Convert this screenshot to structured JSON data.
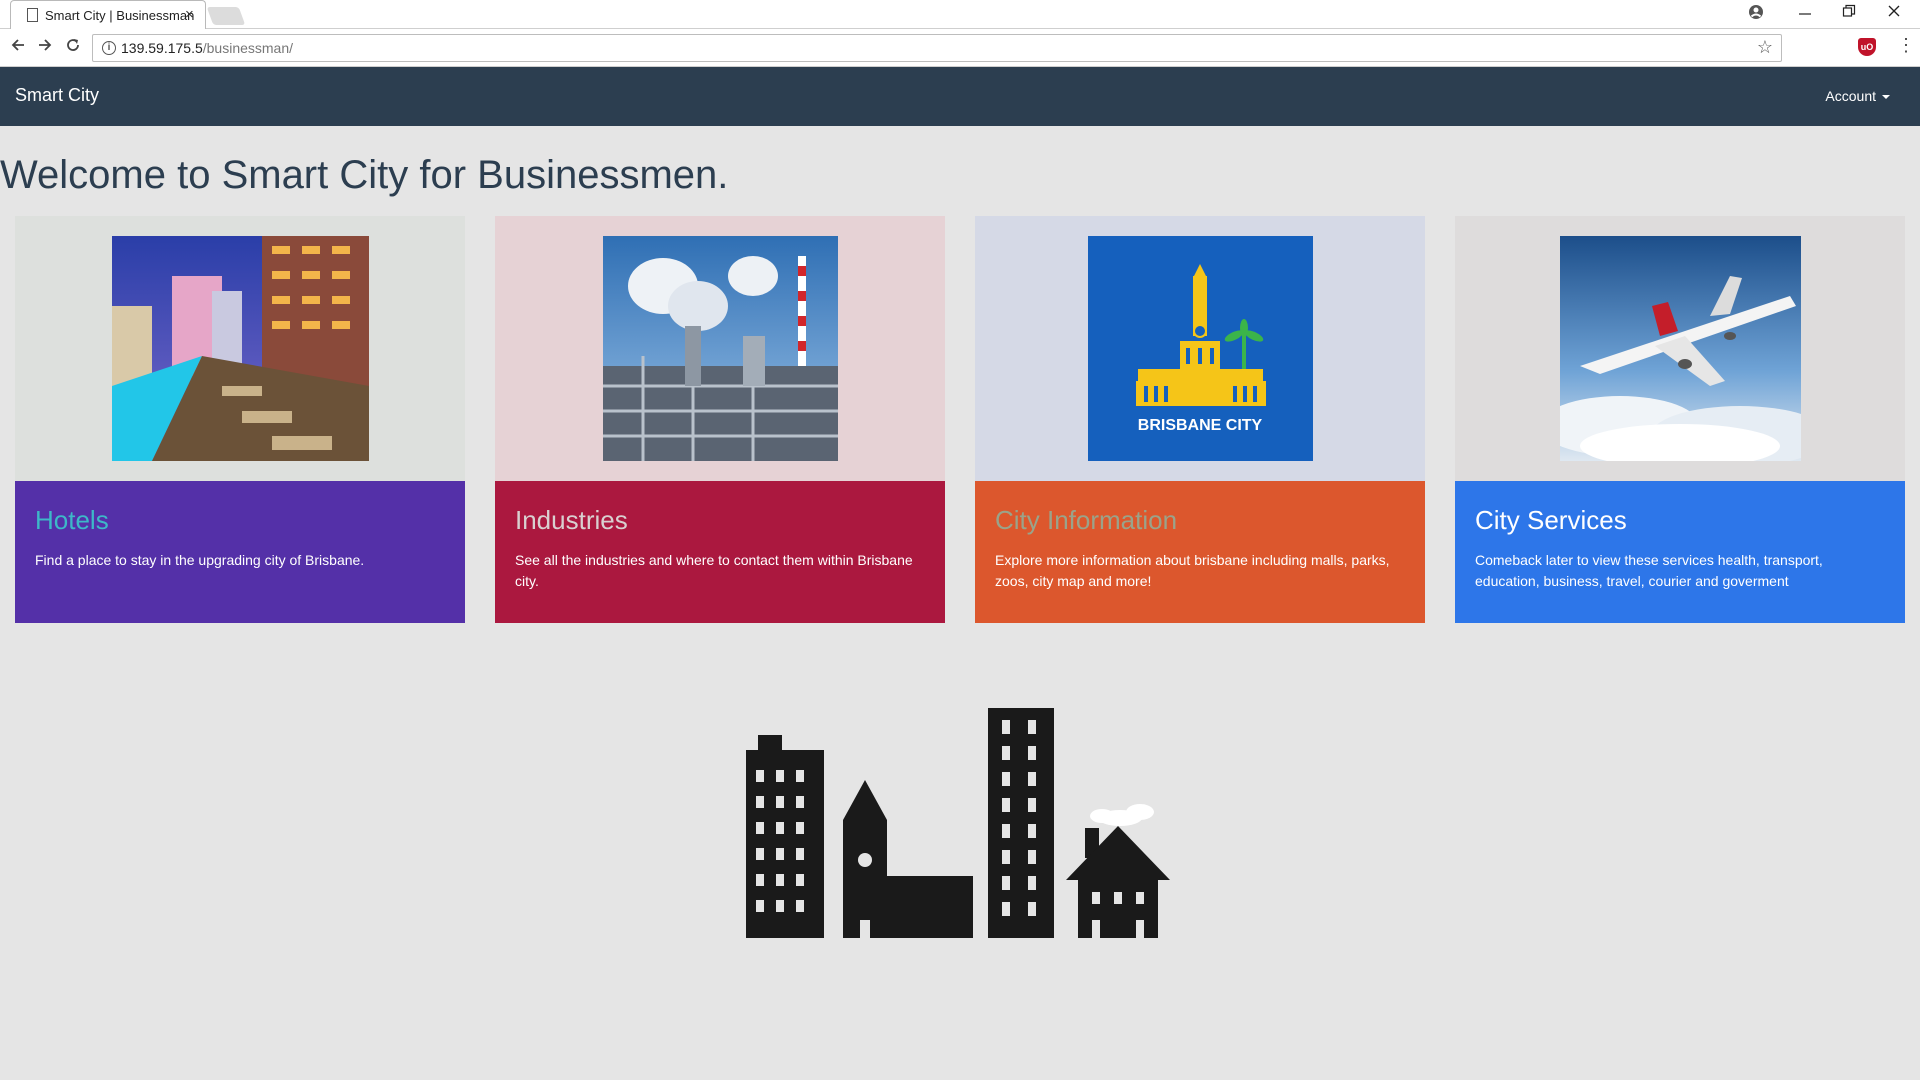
{
  "browser": {
    "tab_title": "Smart City | Businessman",
    "tab_close": "×",
    "url_host": "139.59.175.5",
    "url_path": "/businessman/",
    "info_icon": "i",
    "extension_label": "uO",
    "icons": [
      "back-arrow-icon",
      "forward-arrow-icon",
      "reload-icon",
      "info-icon",
      "star-icon",
      "extension-icon",
      "kebab-menu-icon",
      "profile-icon",
      "minimize-icon",
      "restore-icon",
      "close-icon"
    ]
  },
  "navbar": {
    "brand": "Smart City",
    "account": "Account",
    "background": "#2c3e50"
  },
  "page": {
    "title": "Welcome to Smart City for Businessmen."
  },
  "cards": [
    {
      "title": "Hotels",
      "text": "Find a place to stay in the upgrading city of Brisbane.",
      "top_color": "#dde0dd",
      "bottom_color": "#5430a8",
      "title_color": "#3db8c8",
      "image": "hotel-pool-image"
    },
    {
      "title": "Industries",
      "text": "See all the industries and where to contact them within Brisbane city.",
      "top_color": "#e6d2d5",
      "bottom_color": "#ab183f",
      "title_color": "#d9d0d0",
      "image": "factory-image"
    },
    {
      "title": "City Information",
      "text": "Explore more information about brisbane including malls, parks, zoos, city map and more!",
      "top_color": "#d5d9e6",
      "bottom_color": "#dc572d",
      "title_color": "#9aa38a",
      "image": "brisbane-city-logo",
      "logo_text": "BRISBANE CITY"
    },
    {
      "title": "City Services",
      "text": "Comeback later to view these services health, transport, education, business, travel, courier and goverment",
      "top_color": "#dedcdc",
      "bottom_color": "#2d76e9",
      "title_color": "#ffffff",
      "image": "airplane-image"
    }
  ]
}
